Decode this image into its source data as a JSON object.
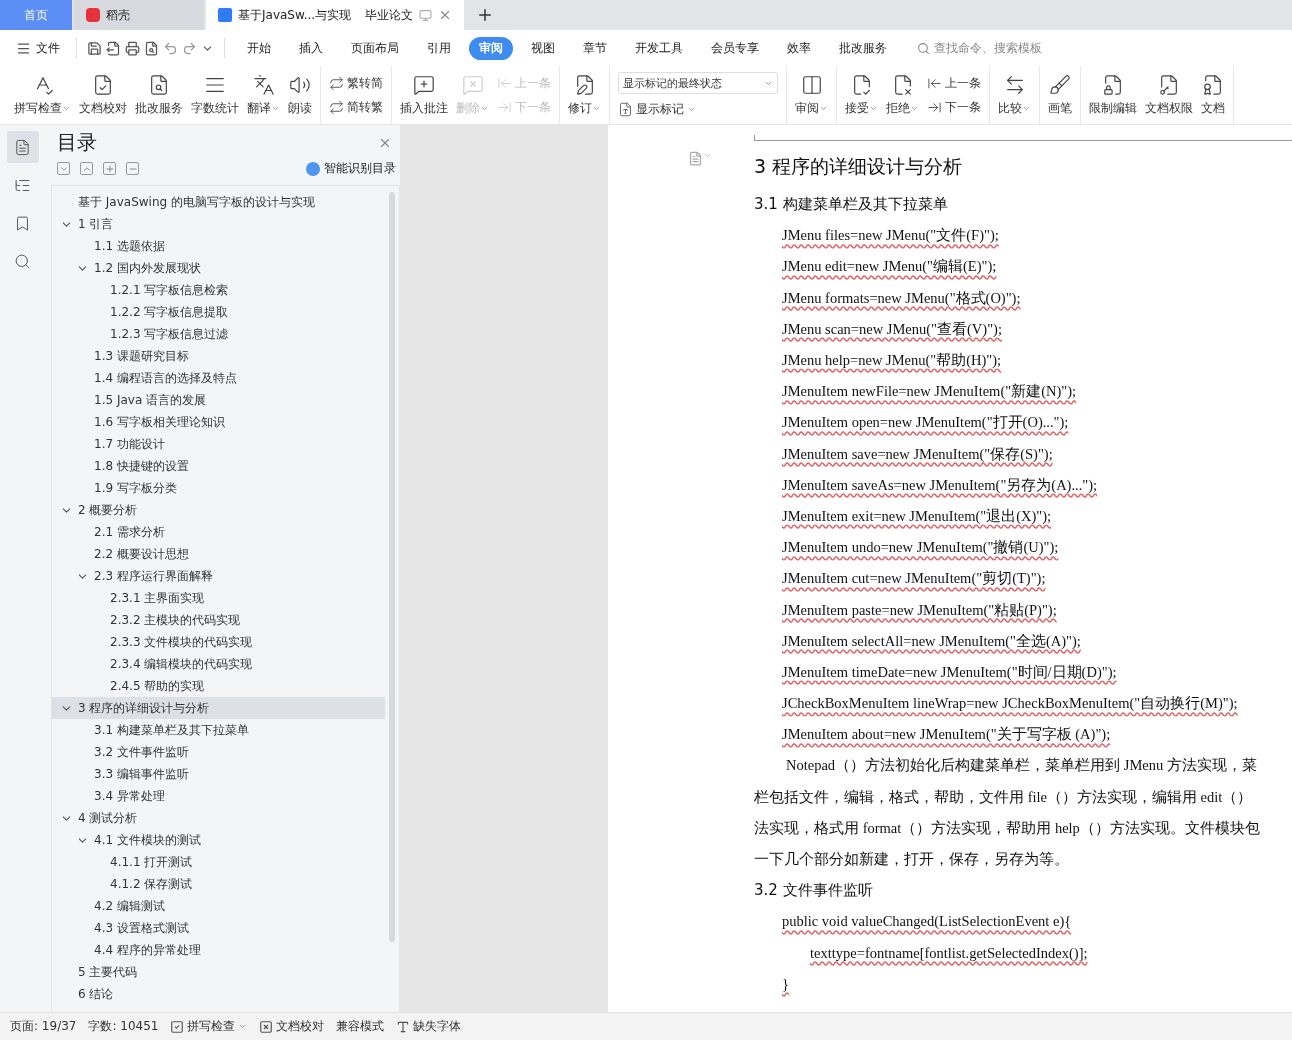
{
  "tabs": [
    {
      "kind": "home",
      "label": "首页",
      "selected": false
    },
    {
      "kind": "docer",
      "label": "稻壳",
      "selected": false
    },
    {
      "kind": "doc",
      "label": "基于JavaSw...与实现",
      "tag": "毕业论文",
      "selected": true
    }
  ],
  "menu": {
    "file": "文件",
    "tabs": [
      {
        "label": "开始",
        "selected": false
      },
      {
        "label": "插入",
        "selected": false
      },
      {
        "label": "页面布局",
        "selected": false
      },
      {
        "label": "引用",
        "selected": false
      },
      {
        "label": "审阅",
        "selected": true
      },
      {
        "label": "视图",
        "selected": false
      },
      {
        "label": "章节",
        "selected": false
      },
      {
        "label": "开发工具",
        "selected": false
      },
      {
        "label": "会员专享",
        "selected": false
      },
      {
        "label": "效率",
        "selected": false
      },
      {
        "label": "批改服务",
        "selected": false
      }
    ],
    "search": {
      "placeholder": "查找命令、搜索模板"
    }
  },
  "ribbon": [
    [
      {
        "kind": "big",
        "label": "拼写检查",
        "dropdown": true,
        "disabled": false
      },
      {
        "kind": "big",
        "label": "文档校对",
        "dropdown": false,
        "disabled": false
      },
      {
        "kind": "big",
        "label": "批改服务",
        "dropdown": false,
        "disabled": false
      },
      {
        "kind": "big",
        "label": "字数统计",
        "dropdown": false,
        "disabled": false
      },
      {
        "kind": "big",
        "label": "翻译",
        "dropdown": true,
        "disabled": false
      },
      {
        "kind": "big",
        "label": "朗读",
        "dropdown": false,
        "disabled": false
      }
    ],
    [
      {
        "kind": "pair",
        "items": [
          {
            "label": "繁转简",
            "disabled": false
          },
          {
            "label": "简转繁",
            "disabled": false
          }
        ]
      }
    ],
    [
      {
        "kind": "big",
        "label": "插入批注",
        "dropdown": false,
        "disabled": false
      },
      {
        "kind": "big",
        "label": "删除",
        "dropdown": true,
        "disabled": true
      },
      {
        "kind": "pair",
        "items": [
          {
            "label": "上一条",
            "disabled": true
          },
          {
            "label": "下一条",
            "disabled": true
          }
        ]
      }
    ],
    [
      {
        "kind": "big",
        "label": "修订",
        "dropdown": true,
        "disabled": false
      }
    ],
    [
      {
        "kind": "select",
        "value": "显示标记的最终状态",
        "label": "显示标记"
      }
    ],
    [
      {
        "kind": "big",
        "label": "审阅",
        "dropdown": true,
        "disabled": false
      }
    ],
    [
      {
        "kind": "big",
        "label": "接受",
        "dropdown": true,
        "disabled": false
      },
      {
        "kind": "big",
        "label": "拒绝",
        "dropdown": true,
        "disabled": false
      },
      {
        "kind": "pair",
        "items": [
          {
            "label": "上一条",
            "disabled": false
          },
          {
            "label": "下一条",
            "disabled": false
          }
        ]
      }
    ],
    [
      {
        "kind": "big",
        "label": "比较",
        "dropdown": true,
        "disabled": false
      }
    ],
    [
      {
        "kind": "big",
        "label": "画笔",
        "dropdown": false,
        "disabled": false
      }
    ],
    [
      {
        "kind": "big",
        "label": "限制编辑",
        "dropdown": false,
        "disabled": false
      },
      {
        "kind": "big",
        "label": "文档权限",
        "dropdown": false,
        "disabled": false
      },
      {
        "kind": "big",
        "label": "文档",
        "dropdown": false,
        "disabled": false
      }
    ]
  ],
  "tool_strip": [
    {
      "selected": true
    },
    {
      "selected": false
    },
    {
      "selected": false
    },
    {
      "selected": false
    }
  ],
  "toc": {
    "title": "目录",
    "smart_button": "智能识别目录",
    "items": [
      {
        "label": "基于 JavaSwing 的电脑写字板的设计与实现",
        "selected": false
      },
      {
        "label": "1  引言",
        "selected": false,
        "expanded": true,
        "children": [
          {
            "label": "1.1  选题依据",
            "selected": false
          },
          {
            "label": "1.2  国内外发展现状",
            "selected": false,
            "expanded": true,
            "children": [
              {
                "label": "1.2.1  写字板信息检索",
                "selected": false
              },
              {
                "label": "1.2.2  写字板信息提取",
                "selected": false
              },
              {
                "label": "1.2.3  写字板信息过滤",
                "selected": false
              }
            ]
          },
          {
            "label": "1.3  课题研究目标",
            "selected": false
          },
          {
            "label": "1.4  编程语言的选择及特点",
            "selected": false
          },
          {
            "label": "1.5 Java 语言的发展",
            "selected": false
          },
          {
            "label": "1.6  写字板相关理论知识",
            "selected": false
          },
          {
            "label": "1.7  功能设计",
            "selected": false
          },
          {
            "label": "1.8  快捷键的设置",
            "selected": false
          },
          {
            "label": "1.9  写字板分类",
            "selected": false
          }
        ]
      },
      {
        "label": "2  概要分析",
        "selected": false,
        "expanded": true,
        "children": [
          {
            "label": "2.1  需求分析",
            "selected": false
          },
          {
            "label": "2.2  概要设计思想",
            "selected": false
          },
          {
            "label": "2.3  程序运行界面解释",
            "selected": false,
            "expanded": true,
            "children": [
              {
                "label": "2.3.1  主界面实现",
                "selected": false
              },
              {
                "label": "2.3.2  主模块的代码实现",
                "selected": false
              },
              {
                "label": "2.3.3  文件模块的代码实现",
                "selected": false
              },
              {
                "label": "2.3.4  编辑模块的代码实现",
                "selected": false
              },
              {
                "label": "2.4.5  帮助的实现",
                "selected": false
              }
            ]
          }
        ]
      },
      {
        "label": "3  程序的详细设计与分析",
        "selected": true,
        "expanded": true,
        "children": [
          {
            "label": "3.1  构建菜单栏及其下拉菜单",
            "selected": false
          },
          {
            "label": "3.2  文件事件监听",
            "selected": false
          },
          {
            "label": "3.3  编辑事件监听",
            "selected": false
          },
          {
            "label": "3.4  异常处理",
            "selected": false
          }
        ]
      },
      {
        "label": "4  测试分析",
        "selected": false,
        "expanded": true,
        "children": [
          {
            "label": "4.1  文件模块的测试",
            "selected": false,
            "expanded": true,
            "children": [
              {
                "label": "4.1.1  打开测试",
                "selected": false
              },
              {
                "label": "4.1.2  保存测试",
                "selected": false
              }
            ]
          },
          {
            "label": "4.2  编辑测试",
            "selected": false
          },
          {
            "label": "4.3  设置格式测试",
            "selected": false
          },
          {
            "label": "4.4  程序的异常处理",
            "selected": false
          }
        ]
      },
      {
        "label": "5  主要代码",
        "selected": false
      },
      {
        "label": "6  结论",
        "selected": false
      }
    ]
  },
  "document": [
    {
      "kind": "h1",
      "text": "3  程序的详细设计与分析"
    },
    {
      "kind": "h2",
      "text": "3.1  构建菜单栏及其下拉菜单"
    },
    {
      "kind": "code",
      "text": "JMenu files=new JMenu(\"文件(F)\");"
    },
    {
      "kind": "code",
      "text": "JMenu edit=new JMenu(\"编辑(E)\");"
    },
    {
      "kind": "code",
      "text": "JMenu formats=new JMenu(\"格式(O)\");"
    },
    {
      "kind": "code",
      "text": "JMenu scan=new JMenu(\"查看(V)\");"
    },
    {
      "kind": "code",
      "text": "JMenu help=new JMenu(\"帮助(H)\");"
    },
    {
      "kind": "code",
      "text": "JMenuItem newFile=new JMenuItem(\"新建(N)\");"
    },
    {
      "kind": "code",
      "text": "JMenuItem open=new JMenuItem(\"打开(O)...\");"
    },
    {
      "kind": "code",
      "text": "JMenuItem save=new JMenuItem(\"保存(S)\");"
    },
    {
      "kind": "code",
      "text": "JMenuItem saveAs=new JMenuItem(\"另存为(A)...\");"
    },
    {
      "kind": "code",
      "text": "JMenuItem exit=new JMenuItem(\"退出(X)\");"
    },
    {
      "kind": "code",
      "text": "JMenuItem undo=new JMenuItem(\"撤销(U)\");"
    },
    {
      "kind": "code",
      "text": "JMenuItem cut=new JMenuItem(\"剪切(T)\");"
    },
    {
      "kind": "code",
      "text": "JMenuItem paste=new JMenuItem(\"粘贴(P)\");"
    },
    {
      "kind": "code",
      "text": "JMenuItem selectAll=new JMenuItem(\"全选(A)\");"
    },
    {
      "kind": "code",
      "text": "JMenuItem timeDate=new JMenuItem(\"时间/日期(D)\");"
    },
    {
      "kind": "code",
      "text": "JCheckBoxMenuItem lineWrap=new JCheckBoxMenuItem(\"自动换行(M)\");"
    },
    {
      "kind": "code",
      "text": "JMenuItem about=new JMenuItem(\"关于写字板   (A)\");"
    },
    {
      "kind": "para_first",
      "text": "Notepad（）方法初始化后构建菜单栏，菜单栏用到 JMenu 方法实现，菜"
    },
    {
      "kind": "para",
      "text": "栏包括文件，编辑，格式，帮助，文件用 file（）方法实现，编辑用 edit（）"
    },
    {
      "kind": "para",
      "text": "法实现，格式用 format（）方法实现，帮助用 help（）方法实现。文件模块包"
    },
    {
      "kind": "para",
      "text": "一下几个部分如新建，打开，保存，另存为等。"
    },
    {
      "kind": "h2",
      "text": "3.2  文件事件监听"
    },
    {
      "kind": "code",
      "text": "public void valueChanged(ListSelectionEvent e){"
    },
    {
      "kind": "code2",
      "text": "texttype=fontname[fontlist.getSelectedIndex()];"
    },
    {
      "kind": "code",
      "text": "}"
    }
  ],
  "status": {
    "page": "页面: 19/37",
    "words": "字数: 10451",
    "spell": "拼写检查",
    "proof": "文档校对",
    "compat": "兼容模式",
    "font": "缺失字体"
  }
}
